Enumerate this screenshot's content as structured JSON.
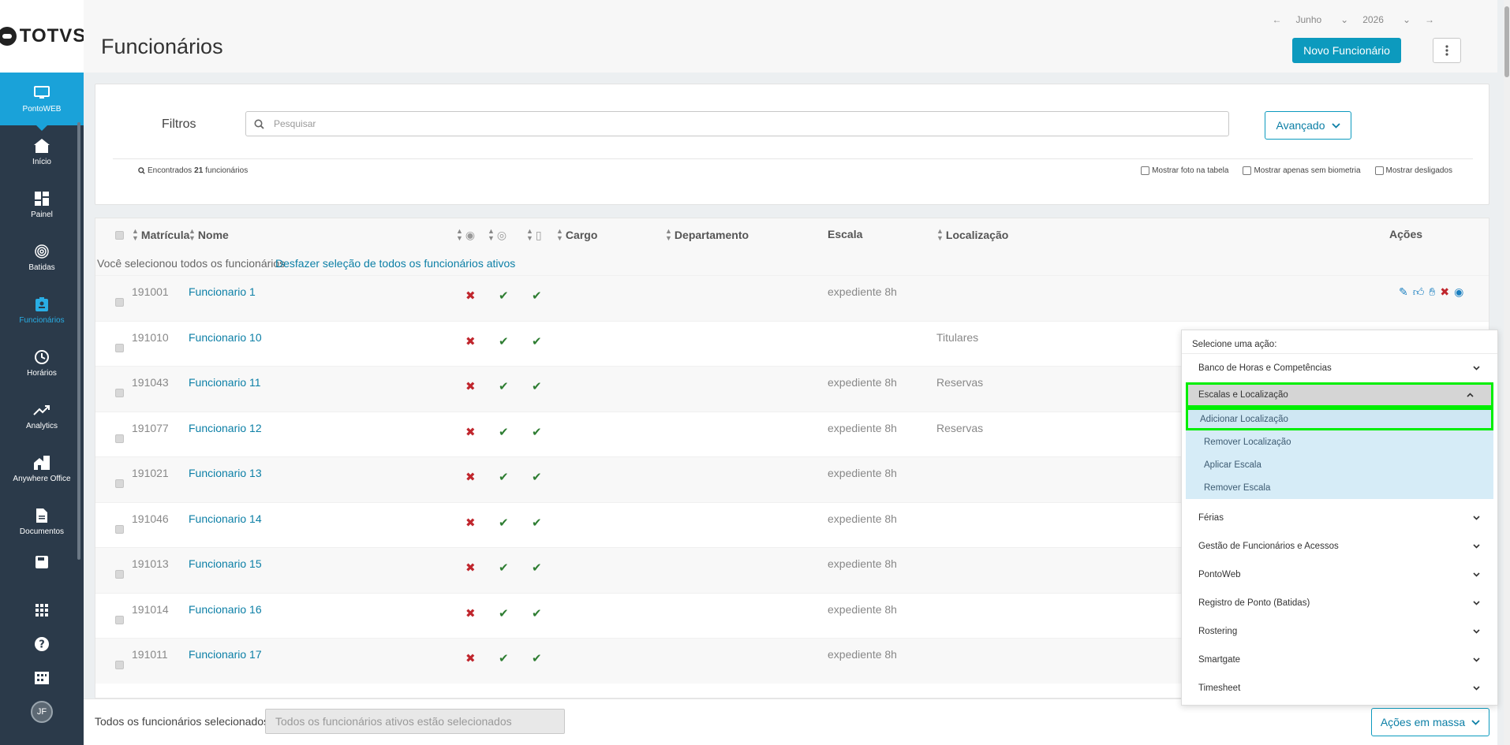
{
  "brand": "TOTVS",
  "sidebar": {
    "items": [
      {
        "label": "PontoWEB",
        "icon": "monitor-icon"
      },
      {
        "label": "Início",
        "icon": "home-icon"
      },
      {
        "label": "Painel",
        "icon": "dashboard-icon"
      },
      {
        "label": "Batidas",
        "icon": "fingerprint-icon"
      },
      {
        "label": "Funcionários",
        "icon": "badge-icon"
      },
      {
        "label": "Horários",
        "icon": "clock-icon"
      },
      {
        "label": "Analytics",
        "icon": "trend-icon"
      },
      {
        "label": "Anywhere Office",
        "icon": "building-home-icon"
      },
      {
        "label": "Documentos",
        "icon": "document-icon"
      }
    ],
    "avatar_initials": "JF"
  },
  "header": {
    "title": "Funcionários",
    "month": "Junho",
    "year": "2026",
    "new_button": "Novo Funcionário"
  },
  "filters": {
    "label": "Filtros",
    "search_placeholder": "Pesquisar",
    "advanced_button": "Avançado",
    "found_prefix": "Encontrados",
    "found_count": "21",
    "found_suffix": "funcionários",
    "options": [
      "Mostrar foto na tabela",
      "Mostrar apenas sem biometria",
      "Mostrar desligados"
    ]
  },
  "table": {
    "headers": {
      "matricula": "Matrícula",
      "nome": "Nome",
      "cargo": "Cargo",
      "departamento": "Departamento",
      "escala": "Escala",
      "localizacao": "Localização",
      "acoes": "Ações"
    },
    "selection_note": "Você selecionou todos os funcionários",
    "undo_selection": "Desfazer seleção de todos os funcionários ativos",
    "rows": [
      {
        "matricula": "191001",
        "nome": "Funcionario 1",
        "escala": "expediente 8h",
        "localizacao": ""
      },
      {
        "matricula": "191010",
        "nome": "Funcionario 10",
        "escala": "",
        "localizacao": "Titulares"
      },
      {
        "matricula": "191043",
        "nome": "Funcionario 11",
        "escala": "expediente 8h",
        "localizacao": "Reservas"
      },
      {
        "matricula": "191077",
        "nome": "Funcionario 12",
        "escala": "expediente 8h",
        "localizacao": "Reservas"
      },
      {
        "matricula": "191021",
        "nome": "Funcionario 13",
        "escala": "expediente 8h",
        "localizacao": ""
      },
      {
        "matricula": "191046",
        "nome": "Funcionario 14",
        "escala": "expediente 8h",
        "localizacao": ""
      },
      {
        "matricula": "191013",
        "nome": "Funcionario 15",
        "escala": "expediente 8h",
        "localizacao": ""
      },
      {
        "matricula": "191014",
        "nome": "Funcionario 16",
        "escala": "expediente 8h",
        "localizacao": ""
      },
      {
        "matricula": "191011",
        "nome": "Funcionario 17",
        "escala": "expediente 8h",
        "localizacao": ""
      }
    ]
  },
  "bottom": {
    "selected_label": "Todos os funcionários selecionados",
    "selected_value": "Todos os funcionários ativos estão selecionados",
    "mass_actions": "Ações em massa"
  },
  "action_panel": {
    "title": "Selecione uma ação:",
    "groups_before": [
      "Banco de Horas e Competências"
    ],
    "open_group": "Escalas e Localização",
    "open_items": [
      "Adicionar Localização",
      "Remover Localização",
      "Aplicar Escala",
      "Remover Escala"
    ],
    "groups_after": [
      "Férias",
      "Gestão de Funcionários e Acessos",
      "PontoWeb",
      "Registro de Ponto (Batidas)",
      "Rostering",
      "Smartgate",
      "Timesheet"
    ]
  },
  "colors": {
    "accent": "#0c9abe",
    "sidebar": "#2b3a4a",
    "active": "#1aa2d9",
    "highlight": "#00ef00",
    "error": "#c0262d",
    "ok": "#2e7d32"
  }
}
